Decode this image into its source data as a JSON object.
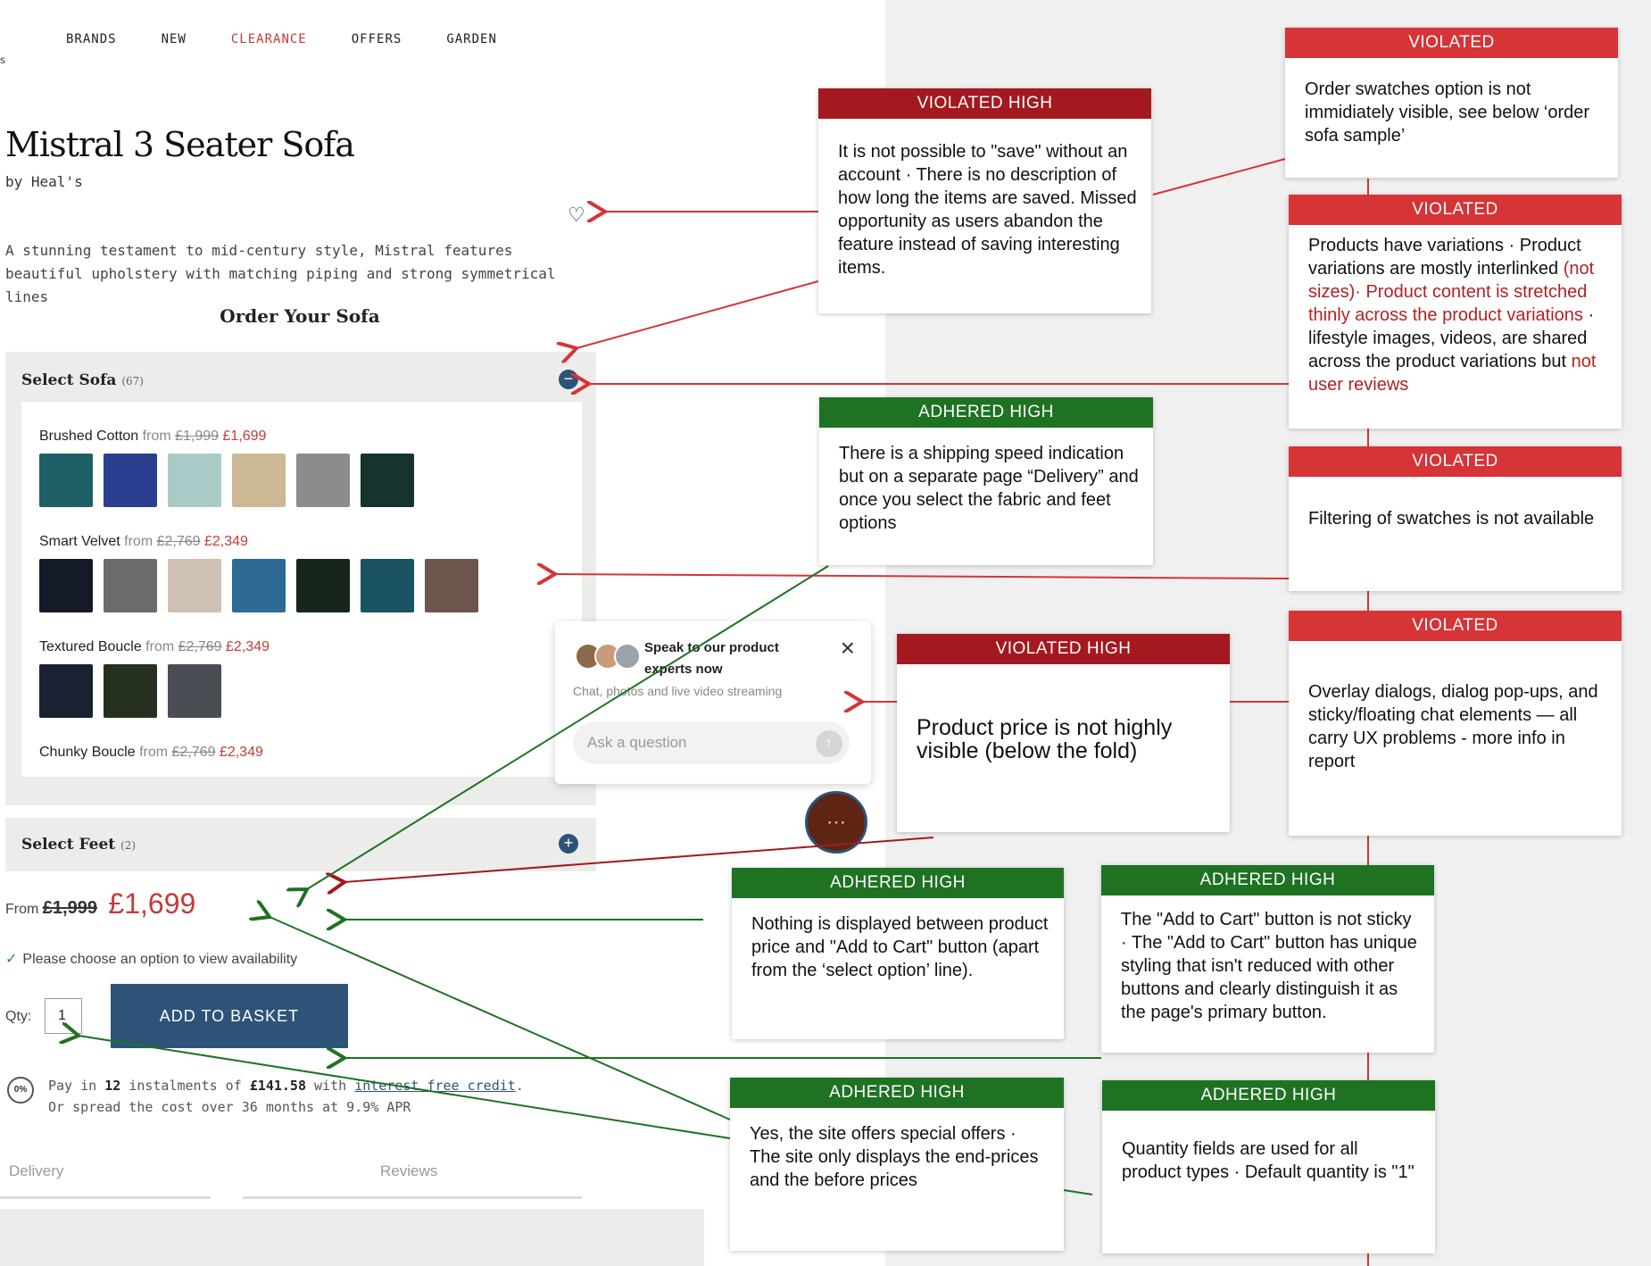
{
  "nav": {
    "items": [
      "BRANDS",
      "NEW",
      "CLEARANCE",
      "OFFERS",
      "GARDEN"
    ],
    "left_mark": "s"
  },
  "product": {
    "title": "Mistral 3 Seater Sofa",
    "brand": "by Heal's",
    "description": "A stunning testament to mid-century style, Mistral features beautiful upholstery with matching piping and strong symmetrical lines",
    "order_heading": "Order Your Sofa",
    "select_sofa": {
      "label": "Select Sofa",
      "count": "(67)"
    },
    "fabrics": [
      {
        "name": "Brushed Cotton",
        "from": "from",
        "old_price": "£1,999",
        "new_price": "£1,699",
        "swatches": [
          "#1f5f66",
          "#2a3f8f",
          "#a9cbc8",
          "#cdb896",
          "#8c8c8c",
          "#16332f"
        ]
      },
      {
        "name": "Smart Velvet",
        "from": "from",
        "old_price": "£2,769",
        "new_price": "£2,349",
        "swatches": [
          "#151a28",
          "#6b6b6b",
          "#cfc1b3",
          "#2d6a94",
          "#17261a",
          "#1a5361",
          "#6e554c"
        ]
      },
      {
        "name": "Textured Boucle",
        "from": "from",
        "old_price": "£2,769",
        "new_price": "£2,349",
        "swatches": [
          "#1a2232",
          "#26301e",
          "#4a4e54"
        ]
      },
      {
        "name": "Chunky Boucle",
        "from": "from",
        "old_price": "£2,769",
        "new_price": "£2,349",
        "swatches": []
      }
    ],
    "select_feet": {
      "label": "Select Feet",
      "count": "(2)"
    },
    "price": {
      "from": "From",
      "old": "£1,999",
      "new": "£1,699"
    },
    "availability": "Please choose an option to view availability",
    "qty_label": "Qty:",
    "qty_value": "1",
    "add_to_basket": "ADD TO BASKET",
    "credit_badge": "0%",
    "credit_line1_a": "Pay in",
    "credit_instalments": "12",
    "credit_line1_b": "instalments of",
    "credit_amount": "£141.58",
    "credit_line1_c": "with",
    "credit_link": "interest free credit",
    "credit_line1_d": ".",
    "credit_line2": "Or spread the cost over 36 months at 9.9% APR",
    "tabs": [
      "Delivery",
      "Reviews"
    ]
  },
  "chat": {
    "title": "Speak to our product experts now",
    "subtitle": "Chat, photos and live video streaming",
    "placeholder": "Ask a question",
    "close": "×",
    "send": "↑",
    "bubble": "⋯",
    "avatar_colors": [
      "#8a6a4a",
      "#c89b7b",
      "#9aa4ad"
    ]
  },
  "annotations": {
    "a1": {
      "header": "VIOLATED HIGH",
      "body": "It is not possible to \"save\" without an account · There is no description of how long the items are saved. Missed opportunity as users abandon the feature instead of saving interesting items."
    },
    "a2": {
      "header": "ADHERED HIGH",
      "body": "There is a shipping speed indication but on a separate page “Delivery” and once you select the fabric and feet options"
    },
    "a3": {
      "header": "VIOLATED HIGH",
      "body": "Product price is not highly visible (below the fold)"
    },
    "a4": {
      "header": "ADHERED HIGH",
      "body": "Nothing is displayed between product price and \"Add to Cart\" button (apart from the ‘select option’ line)."
    },
    "a5": {
      "header": "ADHERED HIGH",
      "body": "Yes, the site offers special offers · The site  only displays the end-prices and the before prices"
    },
    "a6": {
      "header": "ADHERED HIGH",
      "body": "The \"Add to Cart\" button is not sticky · The \"Add to Cart\" button has unique styling that isn't reduced with other buttons and clearly distinguish it as the page's primary button."
    },
    "a7": {
      "header": "ADHERED HIGH",
      "body": "Quantity fields are used for all product types · Default quantity is \"1\""
    },
    "r1": {
      "header": "VIOLATED",
      "body": "Order swatches option is not immidiately visible, see below ‘order sofa sample’"
    },
    "r2": {
      "header": "VIOLATED",
      "body_a": "Products have variations · Product variations are mostly interlinked ",
      "body_b": "(not sizes)· Product content is stretched thinly across the product variations",
      "body_c": " · lifestyle images, videos, are shared across the product variations but ",
      "body_d": "not user reviews"
    },
    "r3": {
      "header": "VIOLATED",
      "body": "Filtering of swatches is not available"
    },
    "r4": {
      "header": "VIOLATED",
      "body": "Overlay dialogs, dialog pop-ups, and sticky/floating chat elements — all carry UX problems  - more info in report"
    }
  },
  "colors": {
    "violated": "#d63436",
    "violated_high": "#a3191f",
    "adhered_high": "#1e7222",
    "basket": "#2d5378",
    "sale": "#c43a3a"
  }
}
